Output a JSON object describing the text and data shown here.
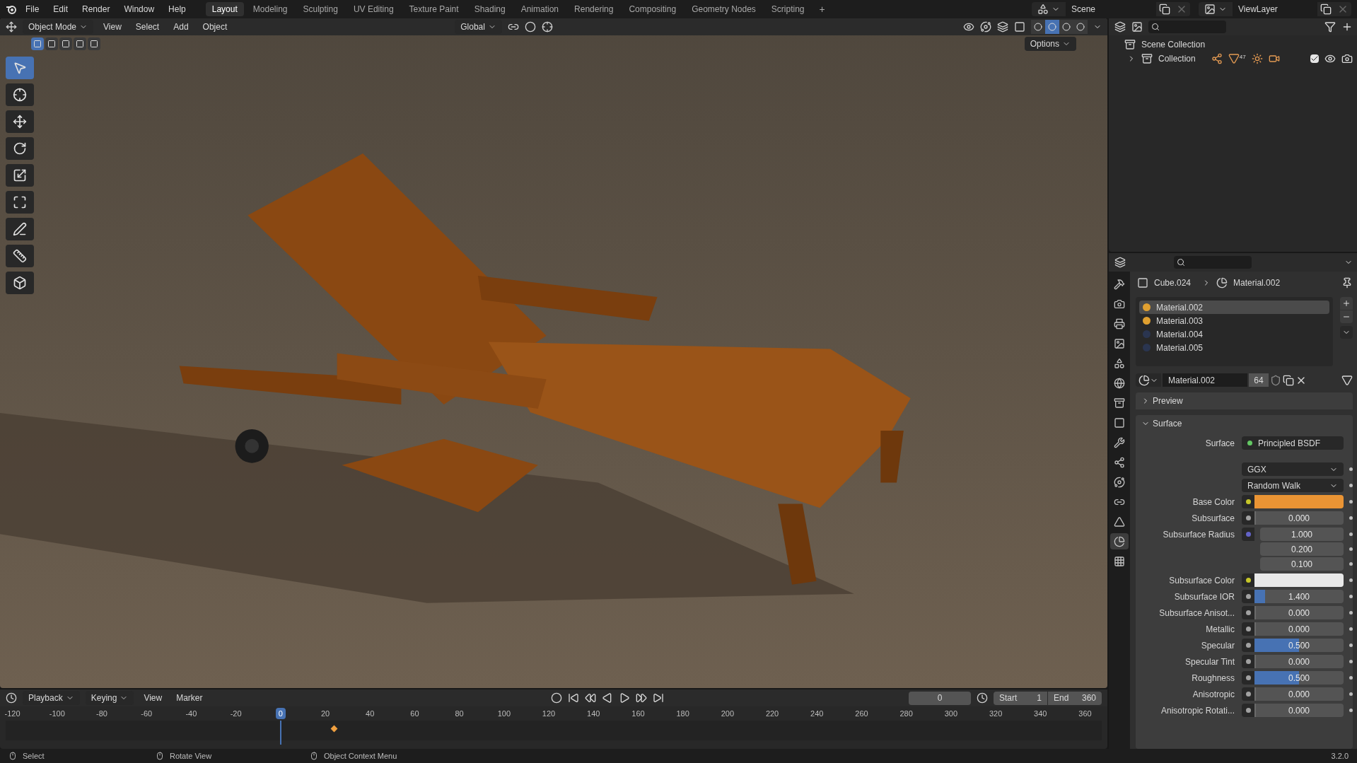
{
  "menu": [
    "File",
    "Edit",
    "Render",
    "Window",
    "Help"
  ],
  "workspaces": [
    {
      "label": "Layout",
      "selected": true
    },
    {
      "label": "Modeling",
      "selected": false
    },
    {
      "label": "Sculpting",
      "selected": false
    },
    {
      "label": "UV Editing",
      "selected": false
    },
    {
      "label": "Texture Paint",
      "selected": false
    },
    {
      "label": "Shading",
      "selected": false
    },
    {
      "label": "Animation",
      "selected": false
    },
    {
      "label": "Rendering",
      "selected": false
    },
    {
      "label": "Compositing",
      "selected": false
    },
    {
      "label": "Geometry Nodes",
      "selected": false
    },
    {
      "label": "Scripting",
      "selected": false
    }
  ],
  "add_workspace": "+",
  "scene": "Scene",
  "view_layer": "ViewLayer",
  "viewport": {
    "mode": "Object Mode",
    "menus": [
      "View",
      "Select",
      "Add",
      "Object"
    ],
    "orientation": "Global",
    "options": "Options",
    "select_modes": [
      {
        "selected": true
      },
      {
        "selected": false
      },
      {
        "selected": false
      },
      {
        "selected": false
      },
      {
        "selected": false
      }
    ],
    "shading": [
      {
        "selected": false
      },
      {
        "selected": true
      },
      {
        "selected": false
      },
      {
        "selected": false
      }
    ],
    "tools": [
      {
        "selected": true
      },
      {
        "selected": false
      },
      {
        "selected": false
      },
      {
        "selected": false
      },
      {
        "selected": false
      },
      {
        "selected": false
      },
      {
        "selected": false
      },
      {
        "selected": false
      },
      {
        "selected": false
      }
    ]
  },
  "outliner": {
    "items": [
      {
        "label": "Scene Collection",
        "children": [
          {
            "label": "Collection",
            "count": "47",
            "checked": true
          }
        ]
      }
    ]
  },
  "properties": {
    "tabs": [
      {
        "selected": false
      },
      {
        "selected": false
      },
      {
        "selected": false
      },
      {
        "selected": false
      },
      {
        "selected": false
      },
      {
        "selected": false
      },
      {
        "selected": false
      },
      {
        "selected": false
      },
      {
        "selected": false
      },
      {
        "selected": false
      },
      {
        "selected": false
      },
      {
        "selected": false
      },
      {
        "selected": false
      },
      {
        "selected": true
      },
      {
        "selected": false
      }
    ],
    "breadcrumb": [
      "Cube.024",
      "Material.002"
    ],
    "slots": [
      {
        "name": "Material.002",
        "selected": true,
        "color": "#e0a030"
      },
      {
        "name": "Material.003",
        "selected": false,
        "color": "#e0a030"
      },
      {
        "name": "Material.004",
        "selected": false,
        "color": "#2a3550"
      },
      {
        "name": "Material.005",
        "selected": false,
        "color": "#2a3550"
      }
    ],
    "material": {
      "name": "Material.002",
      "users": "64"
    },
    "panels": [
      {
        "label": "Preview",
        "expanded": false
      },
      {
        "label": "Surface",
        "expanded": true
      }
    ],
    "surface": {
      "label": "Surface",
      "value": "Principled BSDF"
    },
    "dropdowns": [
      "GGX",
      "Random Walk"
    ],
    "fields": [
      {
        "label": "Base Color",
        "kind": "color",
        "color": "#ea9434",
        "socket": {
          "color": "#c7c729"
        }
      },
      {
        "label": "Subsurface",
        "kind": "value",
        "value": "0.000",
        "level": 0,
        "socket": {
          "color": "#a1a1a1"
        }
      },
      {
        "label": "Subsurface Radius",
        "kind": "vector",
        "values": [
          "1.000",
          "0.200",
          "0.100"
        ],
        "socket": {
          "color": "#6363c7"
        }
      },
      {
        "label": "Subsurface Color",
        "kind": "color",
        "color": "#e8e8e8",
        "socket": {
          "color": "#c7c729"
        }
      },
      {
        "label": "Subsurface IOR",
        "kind": "value",
        "value": "1.400",
        "level": 0.12,
        "socket": {
          "color": "#a1a1a1"
        }
      },
      {
        "label": "Subsurface Anisot...",
        "kind": "value",
        "value": "0.000",
        "level": 0,
        "socket": {
          "color": "#a1a1a1"
        }
      },
      {
        "label": "Metallic",
        "kind": "value",
        "value": "0.000",
        "level": 0,
        "socket": {
          "color": "#a1a1a1"
        }
      },
      {
        "label": "Specular",
        "kind": "value",
        "value": "0.500",
        "level": 0.5,
        "socket": {
          "color": "#a1a1a1"
        }
      },
      {
        "label": "Specular Tint",
        "kind": "value",
        "value": "0.000",
        "level": 0,
        "socket": {
          "color": "#a1a1a1"
        }
      },
      {
        "label": "Roughness",
        "kind": "value",
        "value": "0.500",
        "level": 0.5,
        "socket": {
          "color": "#a1a1a1"
        }
      },
      {
        "label": "Anisotropic",
        "kind": "value",
        "value": "0.000",
        "level": 0,
        "socket": {
          "color": "#a1a1a1"
        }
      },
      {
        "label": "Anisotropic Rotati...",
        "kind": "value",
        "value": "0.000",
        "level": 0,
        "socket": {
          "color": "#a1a1a1"
        }
      }
    ]
  },
  "timeline": {
    "menus": [
      "Playback",
      "Keying",
      "View",
      "Marker"
    ],
    "current_frame": "0",
    "start_label": "Start",
    "start": "1",
    "end_label": "End",
    "end": "360",
    "ticks": [
      {
        "label": "-120",
        "selected": false
      },
      {
        "label": "-100",
        "selected": false
      },
      {
        "label": "-80",
        "selected": false
      },
      {
        "label": "-60",
        "selected": false
      },
      {
        "label": "-40",
        "selected": false
      },
      {
        "label": "-20",
        "selected": false
      },
      {
        "label": "0",
        "selected": true
      },
      {
        "label": "20",
        "selected": false
      },
      {
        "label": "40",
        "selected": false
      },
      {
        "label": "60",
        "selected": false
      },
      {
        "label": "80",
        "selected": false
      },
      {
        "label": "100",
        "selected": false
      },
      {
        "label": "120",
        "selected": false
      },
      {
        "label": "140",
        "selected": false
      },
      {
        "label": "160",
        "selected": false
      },
      {
        "label": "180",
        "selected": false
      },
      {
        "label": "200",
        "selected": false
      },
      {
        "label": "220",
        "selected": false
      },
      {
        "label": "240",
        "selected": false
      },
      {
        "label": "260",
        "selected": false
      },
      {
        "label": "280",
        "selected": false
      },
      {
        "label": "300",
        "selected": false
      },
      {
        "label": "320",
        "selected": false
      },
      {
        "label": "340",
        "selected": false
      },
      {
        "label": "360",
        "selected": false
      }
    ]
  },
  "status_bar": {
    "hints": [
      "Select",
      "Rotate View",
      "Object Context Menu"
    ],
    "version": "3.2.0"
  }
}
